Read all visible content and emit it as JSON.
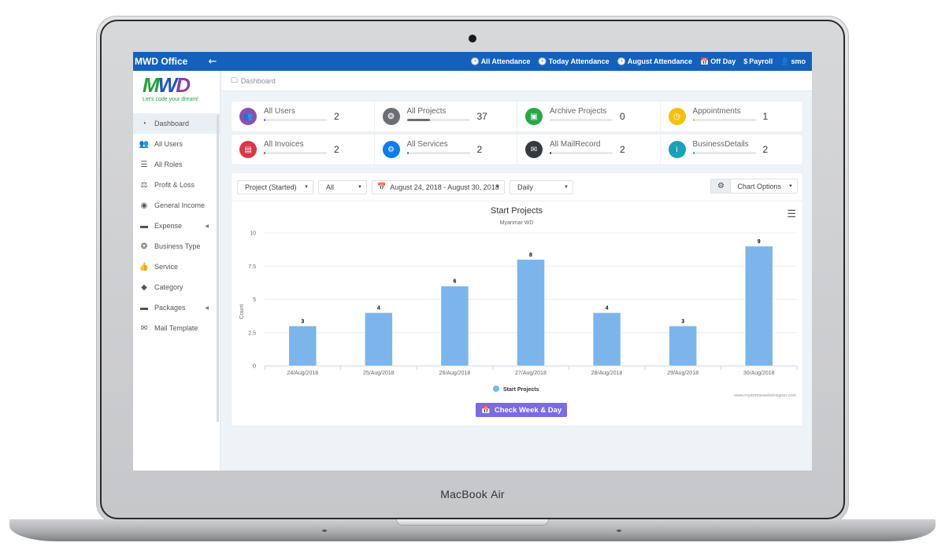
{
  "device": {
    "label_brand": "MacBook",
    "label_model": "Air"
  },
  "header": {
    "app_title": "MWD Office",
    "nav": [
      {
        "icon": "clock-icon",
        "label": "All Attendance"
      },
      {
        "icon": "clock-icon",
        "label": "Today Attendance"
      },
      {
        "icon": "clock-icon",
        "label": "August Attendance"
      },
      {
        "icon": "calendar-icon",
        "label": "Off Day"
      },
      {
        "icon": "dollar-icon",
        "label": "Payroll"
      },
      {
        "icon": "user-icon",
        "label": "smo"
      }
    ]
  },
  "logo": {
    "tagline": "Let's code your dream!"
  },
  "sidebar": {
    "items": [
      {
        "label": "Dashboard",
        "icon": "tachometer-icon",
        "active": true
      },
      {
        "label": "All Users",
        "icon": "users-icon"
      },
      {
        "label": "All Roles",
        "icon": "indent-icon"
      },
      {
        "label": "Profit & Loss",
        "icon": "balance-scale-icon"
      },
      {
        "label": "General Income",
        "icon": "money-icon"
      },
      {
        "label": "Expense",
        "icon": "folder-icon",
        "submenu": true
      },
      {
        "label": "Business Type",
        "icon": "cubes-icon"
      },
      {
        "label": "Service",
        "icon": "thumbs-up-icon"
      },
      {
        "label": "Category",
        "icon": "tag-icon"
      },
      {
        "label": "Packages",
        "icon": "folder-icon",
        "submenu": true
      },
      {
        "label": "Mail Template",
        "icon": "envelope-icon"
      }
    ]
  },
  "breadcrumb": {
    "label": "Dashboard"
  },
  "stats": [
    {
      "label": "All Users",
      "value": "2",
      "color": "#8e4fae",
      "progress": 0.02
    },
    {
      "label": "All Projects",
      "value": "37",
      "color": "#6b6f73",
      "progress": 0.37
    },
    {
      "label": "Archive Projects",
      "value": "0",
      "color": "#27a844",
      "progress": 0
    },
    {
      "label": "Appointments",
      "value": "1",
      "color": "#f5c00d",
      "progress": 0.01
    },
    {
      "label": "All Invoices",
      "value": "2",
      "color": "#dc3545",
      "progress": 0.02
    },
    {
      "label": "All Services",
      "value": "2",
      "color": "#0d7ef2",
      "progress": 0.02
    },
    {
      "label": "All MailRecord",
      "value": "2",
      "color": "#343a40",
      "progress": 0.02
    },
    {
      "label": "BusinessDetails",
      "value": "2",
      "color": "#17a2b8",
      "progress": 0.02
    }
  ],
  "filters": {
    "type": "Project (Started)",
    "scope": "All",
    "date_range": "August 24, 2018 - August 30, 2018",
    "interval": "Daily",
    "chart_options": "Chart Options"
  },
  "chart_data": {
    "type": "bar",
    "title": "Start Projects",
    "subtitle": "Myanmar WD",
    "xlabel": "",
    "ylabel": "Count",
    "ylim": [
      0,
      10
    ],
    "yticks": [
      0,
      2.5,
      5,
      7.5,
      10
    ],
    "grid": true,
    "legend_position": "bottom",
    "categories": [
      "24/Aug/2018",
      "25/Aug/2018",
      "26/Aug/2018",
      "27/Aug/2018",
      "28/Aug/2018",
      "29/Aug/2018",
      "30/Aug/2018"
    ],
    "series": [
      {
        "name": "Start Projects",
        "color": "#7cb5ec",
        "values": [
          3,
          4,
          6,
          8,
          4,
          3,
          9
        ]
      }
    ],
    "credit": "www.myanmarwebdesigner.com"
  },
  "actions": {
    "check_week_day": "Check Week & Day"
  }
}
